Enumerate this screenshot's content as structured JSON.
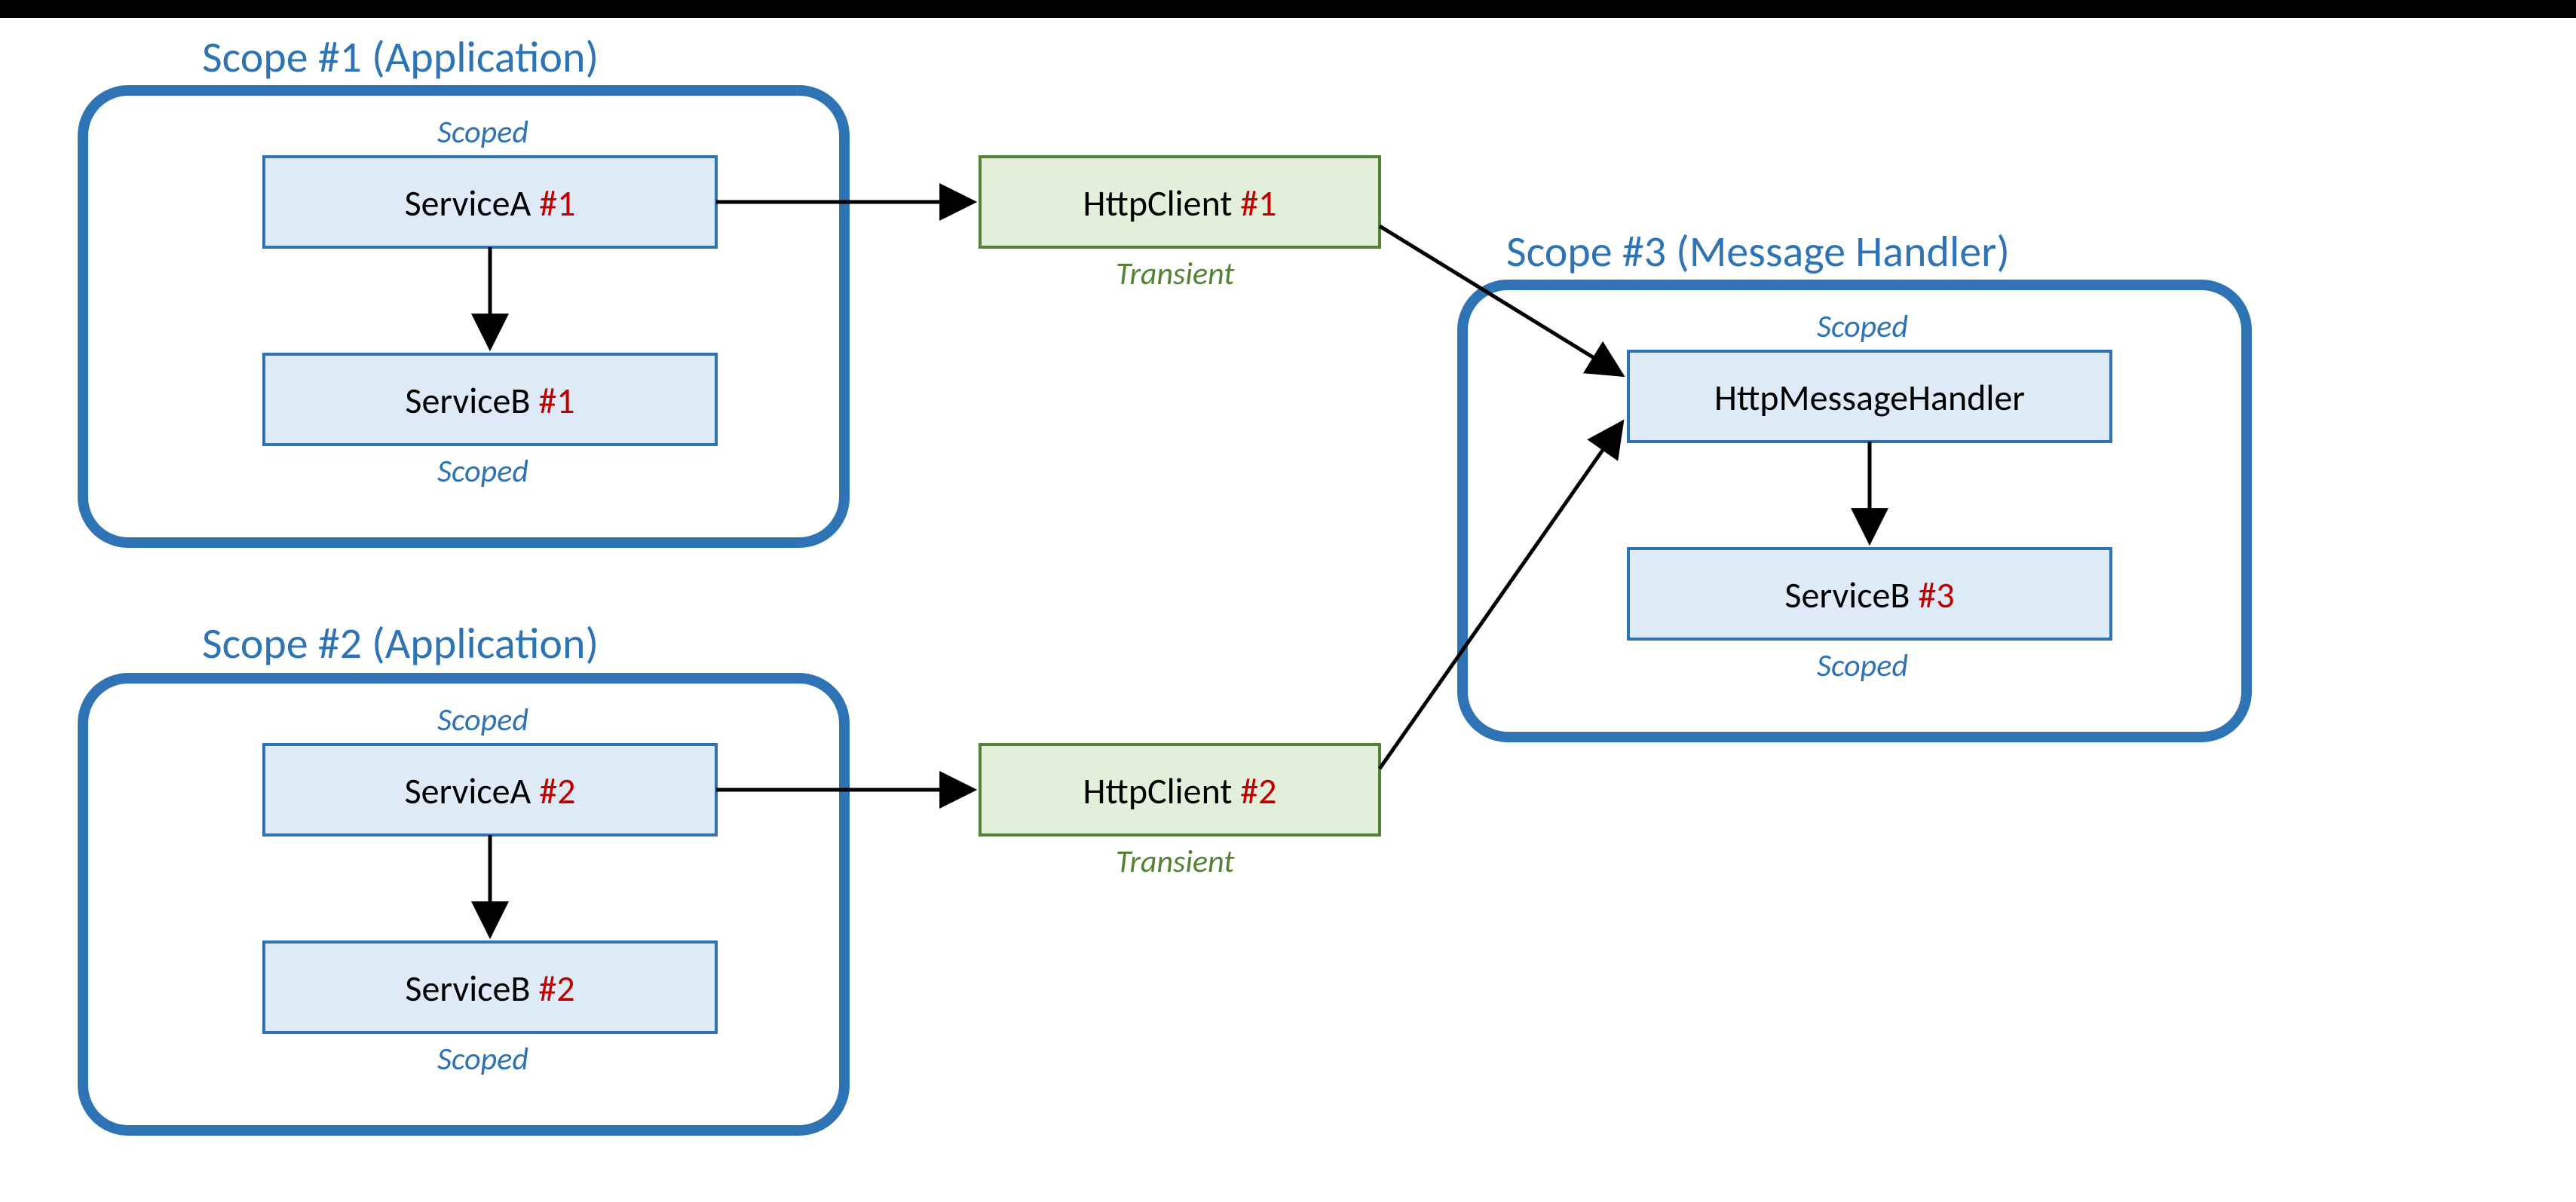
{
  "scopes": {
    "s1_title": "Scope #1 (Application)",
    "s2_title": "Scope #2 (Application)",
    "s3_title": "Scope #3 (Message Handler)"
  },
  "lifetimes": {
    "scoped": "Scoped",
    "transient": "Transient"
  },
  "boxes": {
    "serviceA1_a": "ServiceA ",
    "serviceA1_b": "#1",
    "serviceB1_a": "ServiceB ",
    "serviceB1_b": "#1",
    "serviceA2_a": "ServiceA ",
    "serviceA2_b": "#2",
    "serviceB2_a": "ServiceB ",
    "serviceB2_b": "#2",
    "httpClient1_a": "HttpClient ",
    "httpClient1_b": "#1",
    "httpClient2_a": "HttpClient ",
    "httpClient2_b": "#2",
    "handler": "HttpMessageHandler",
    "serviceB3_a": "ServiceB ",
    "serviceB3_b": "#3"
  },
  "colors": {
    "scope_border": "#2e74b5",
    "blue_fill": "#deebf7",
    "blue_border": "#2e74b5",
    "green_fill": "#e2efda",
    "green_border": "#548235",
    "arrow": "#000000",
    "instance_number": "#c00000"
  },
  "chart_data": {
    "type": "diagram",
    "description": "Dependency-injection scope diagram: two application scopes each resolve a scoped ServiceA and ServiceB; each ServiceA depends on a transient HttpClient; both HttpClient instances share a single HttpMessageHandler created in its own message-handler scope, which in turn resolves its own scoped ServiceB (#3).",
    "nodes": [
      {
        "id": "scope1",
        "type": "scope",
        "label": "Scope #1 (Application)"
      },
      {
        "id": "scope2",
        "type": "scope",
        "label": "Scope #2 (Application)"
      },
      {
        "id": "scope3",
        "type": "scope",
        "label": "Scope #3 (Message Handler)"
      },
      {
        "id": "serviceA1",
        "type": "service",
        "label": "ServiceA #1",
        "lifetime": "Scoped",
        "scope": "scope1"
      },
      {
        "id": "serviceB1",
        "type": "service",
        "label": "ServiceB #1",
        "lifetime": "Scoped",
        "scope": "scope1"
      },
      {
        "id": "serviceA2",
        "type": "service",
        "label": "ServiceA #2",
        "lifetime": "Scoped",
        "scope": "scope2"
      },
      {
        "id": "serviceB2",
        "type": "service",
        "label": "ServiceB #2",
        "lifetime": "Scoped",
        "scope": "scope2"
      },
      {
        "id": "httpClient1",
        "type": "service",
        "label": "HttpClient #1",
        "lifetime": "Transient",
        "scope": null
      },
      {
        "id": "httpClient2",
        "type": "service",
        "label": "HttpClient #2",
        "lifetime": "Transient",
        "scope": null
      },
      {
        "id": "handler",
        "type": "service",
        "label": "HttpMessageHandler",
        "lifetime": "Scoped",
        "scope": "scope3"
      },
      {
        "id": "serviceB3",
        "type": "service",
        "label": "ServiceB #3",
        "lifetime": "Scoped",
        "scope": "scope3"
      }
    ],
    "edges": [
      {
        "from": "serviceA1",
        "to": "serviceB1"
      },
      {
        "from": "serviceA1",
        "to": "httpClient1"
      },
      {
        "from": "serviceA2",
        "to": "serviceB2"
      },
      {
        "from": "serviceA2",
        "to": "httpClient2"
      },
      {
        "from": "httpClient1",
        "to": "handler"
      },
      {
        "from": "httpClient2",
        "to": "handler"
      },
      {
        "from": "handler",
        "to": "serviceB3"
      }
    ]
  }
}
